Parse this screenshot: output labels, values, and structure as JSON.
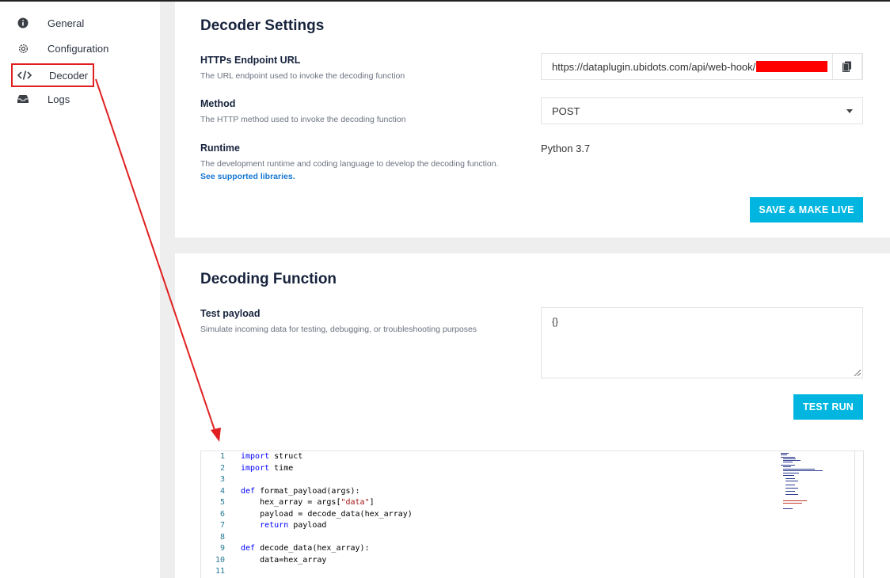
{
  "sidebar": {
    "items": [
      {
        "label": "General",
        "icon": "info-icon"
      },
      {
        "label": "Configuration",
        "icon": "gear-icon"
      },
      {
        "label": "Decoder",
        "icon": "code-icon"
      },
      {
        "label": "Logs",
        "icon": "inbox-icon"
      }
    ],
    "active": "Decoder"
  },
  "decoder_settings": {
    "title": "Decoder Settings",
    "endpoint": {
      "label": "HTTPs Endpoint URL",
      "desc": "The URL endpoint used to invoke the decoding function",
      "value": "https://dataplugin.ubidots.com/api/web-hook/"
    },
    "method": {
      "label": "Method",
      "desc": "The HTTP method used to invoke the decoding function",
      "value": "POST"
    },
    "runtime": {
      "label": "Runtime",
      "desc_part1": "The development runtime and coding language to develop the decoding function. ",
      "link": "See supported libraries.",
      "value": "Python 3.7"
    },
    "save_button": "SAVE & MAKE LIVE"
  },
  "decoding_function": {
    "title": "Decoding Function",
    "payload": {
      "label": "Test payload",
      "desc": "Simulate incoming data for testing, debugging, or troubleshooting purposes",
      "value": "{}"
    },
    "test_button": "TEST RUN"
  },
  "code_lines": [
    "import struct",
    "import time",
    "",
    "def format_payload(args):",
    "    hex_array = args[\"data\"]",
    "    payload = decode_data(hex_array)",
    "    return payload",
    "",
    "def decode_data(hex_array):",
    "    data=hex_array",
    ""
  ],
  "line_numbers": [
    "1",
    "2",
    "3",
    "4",
    "5",
    "6",
    "7",
    "8",
    "9",
    "10",
    "11"
  ],
  "colors": {
    "accent": "#00b6e0",
    "annotation": "#e02020",
    "link": "#1677d2"
  }
}
